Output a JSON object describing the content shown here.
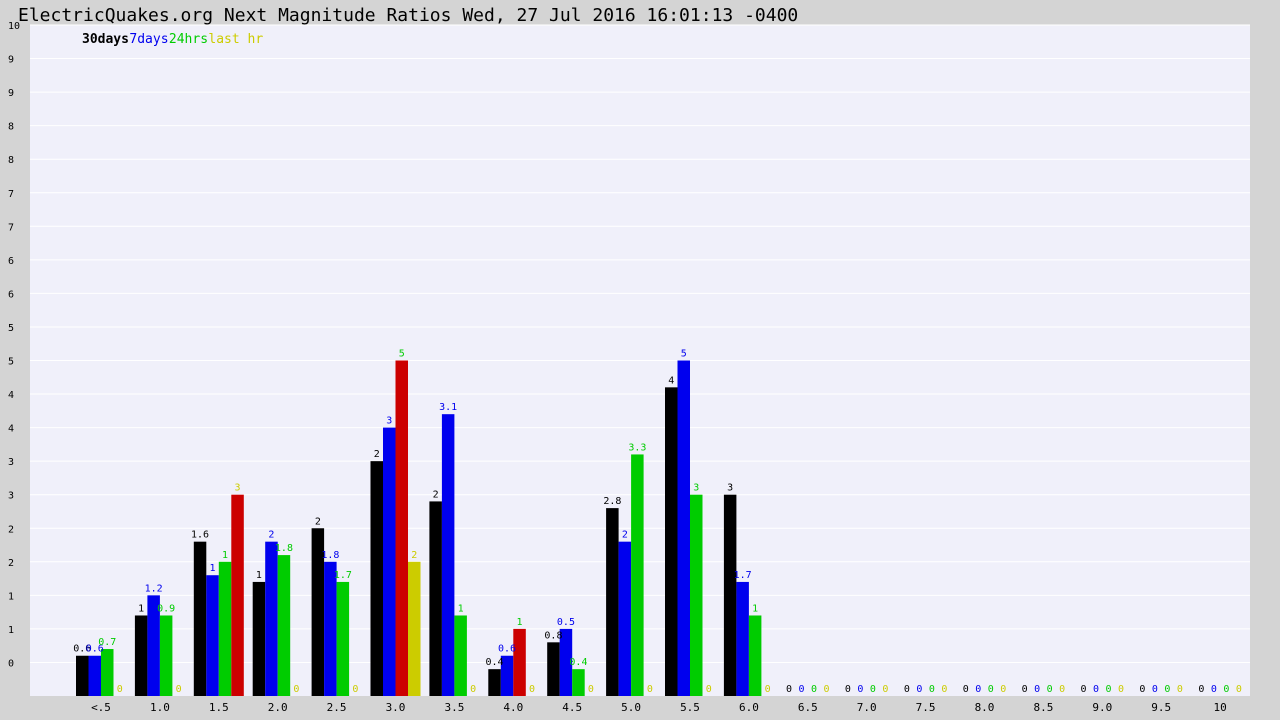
{
  "chart_data": {
    "type": "bar",
    "title": "ElectricQuakes.org Next Magnitude Ratios Wed, 27 Jul 2016 16:01:13 -0400",
    "xlabel": "",
    "ylabel": "",
    "ylim": [
      0,
      10
    ],
    "grid": true,
    "legend_placement": "top-left",
    "y_tick_labels": [
      "0",
      "1",
      "1",
      "2",
      "2",
      "3",
      "3",
      "4",
      "4",
      "5",
      "5",
      "6",
      "6",
      "7",
      "7",
      "8",
      "8",
      "9",
      "9",
      "10"
    ],
    "categories": [
      "<.5",
      "1.0",
      "1.5",
      "2.0",
      "2.5",
      "3.0",
      "3.5",
      "4.0",
      "4.5",
      "5.0",
      "5.5",
      "6.0",
      "6.5",
      "7.0",
      "7.5",
      "8.0",
      "8.5",
      "9.0",
      "9.5",
      "10"
    ],
    "series": [
      {
        "name": "30days",
        "color": "#000000",
        "values": [
          0.6,
          1.0,
          1.6,
          1.0,
          2.0,
          2.0,
          2.0,
          0.4,
          0.8,
          2.8,
          4.0,
          3.0,
          0,
          0,
          0,
          0,
          0,
          0,
          0,
          0
        ],
        "heights": [
          0.6,
          1.2,
          2.3,
          1.7,
          2.5,
          3.5,
          2.9,
          0.4,
          0.8,
          2.8,
          4.6,
          3.0,
          0,
          0,
          0,
          0,
          0,
          0,
          0,
          0
        ]
      },
      {
        "name": "7days",
        "color": "#0000ee",
        "values": [
          0.6,
          1.2,
          1.0,
          2.0,
          1.8,
          3.0,
          3.1,
          0.6,
          0.5,
          2.0,
          5.0,
          1.7,
          0,
          0,
          0,
          0,
          0,
          0,
          0,
          0
        ],
        "heights": [
          0.6,
          1.5,
          1.8,
          2.3,
          2.0,
          4.0,
          4.2,
          0.6,
          1.0,
          2.3,
          5.0,
          1.7,
          0,
          0,
          0,
          0,
          0,
          0,
          0,
          0
        ]
      },
      {
        "name": "24hrs",
        "color": "#00cc00",
        "values": [
          0.7,
          0.9,
          1.0,
          1.8,
          1.7,
          5.0,
          1.0,
          1.0,
          0.4,
          3.3,
          3.0,
          1.0,
          0,
          0,
          0,
          0,
          0,
          0,
          0,
          0
        ],
        "heights": [
          0.7,
          1.2,
          2.0,
          2.1,
          1.7,
          5.0,
          1.2,
          1.0,
          0.4,
          3.6,
          3.0,
          1.2,
          0,
          0,
          0,
          0,
          0,
          0,
          0,
          0
        ],
        "label_colors": [
          "#00cc00",
          "#00cc00",
          "#00cc00",
          "#00cc00",
          "#00cc00",
          "#00cc00",
          "#00cc00",
          "#00cc00",
          "#00cc00",
          "#00cc00",
          "#00cc00",
          "#00cc00",
          "#00cc00",
          "#00cc00",
          "#00cc00",
          "#00cc00",
          "#00cc00",
          "#00cc00",
          "#00cc00",
          "#00cc00"
        ],
        "bar_colors": [
          "#00cc00",
          "#00cc00",
          "#00cc00",
          "#00cc00",
          "#00cc00",
          "#cc0000",
          "#00cc00",
          "#cc0000",
          "#00cc00",
          "#00cc00",
          "#00cc00",
          "#00cc00",
          "#00cc00",
          "#00cc00",
          "#00cc00",
          "#00cc00",
          "#00cc00",
          "#00cc00",
          "#00cc00",
          "#00cc00"
        ]
      },
      {
        "name": "last hr",
        "color": "#cccc00",
        "values": [
          0,
          0,
          3,
          0,
          0,
          2,
          0,
          0,
          0,
          0,
          0,
          0,
          0,
          0,
          0,
          0,
          0,
          0,
          0,
          0
        ],
        "heights": [
          0,
          0,
          3.0,
          0,
          0,
          2.0,
          0,
          0,
          0,
          0,
          0,
          0,
          0,
          0,
          0,
          0,
          0,
          0,
          0,
          0
        ],
        "bar_colors": [
          "#cccc00",
          "#cccc00",
          "#cc0000",
          "#cccc00",
          "#cccc00",
          "#cccc00",
          "#cccc00",
          "#cccc00",
          "#cccc00",
          "#cccc00",
          "#cccc00",
          "#cccc00",
          "#cccc00",
          "#cccc00",
          "#cccc00",
          "#cccc00",
          "#cccc00",
          "#cccc00",
          "#cccc00",
          "#cccc00"
        ]
      }
    ]
  },
  "colors": {
    "page_background": "#d4d4d4",
    "plot_background": "#f0f0fa",
    "grid": "#ffffff"
  }
}
